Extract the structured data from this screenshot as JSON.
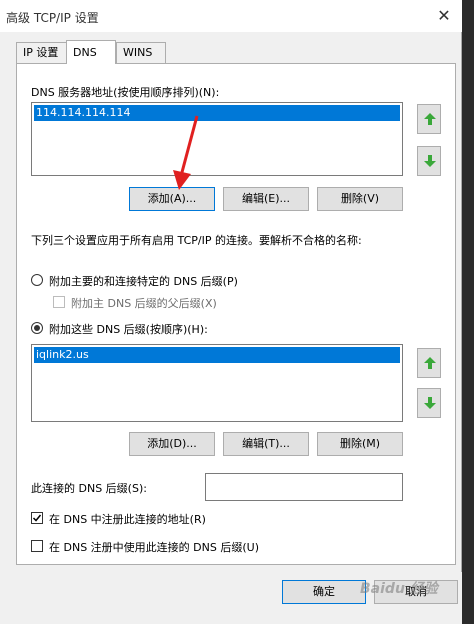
{
  "window": {
    "title": "高级 TCP/IP 设置",
    "close_glyph": "✕"
  },
  "tabs": [
    {
      "label": "IP 设置",
      "active": false
    },
    {
      "label": "DNS",
      "active": true
    },
    {
      "label": "WINS",
      "active": false
    }
  ],
  "dns_servers": {
    "label": "DNS 服务器地址(按使用顺序排列)(N):",
    "items": [
      "114.114.114.114"
    ],
    "add_label": "添加(A)...",
    "edit_label": "编辑(E)...",
    "remove_label": "删除(V)"
  },
  "description": "下列三个设置应用于所有启用 TCP/IP 的连接。要解析不合格的名称:",
  "options": {
    "primary_suffix_label": "附加主要的和连接特定的 DNS 后缀(P)",
    "parent_suffix_label": "附加主 DNS 后缀的父后缀(X)",
    "these_suffixes_label": "附加这些 DNS 后缀(按顺序)(H):"
  },
  "suffix_list": {
    "items": [
      "iqlink2.us"
    ],
    "add_label": "添加(D)...",
    "edit_label": "编辑(T)...",
    "remove_label": "删除(M)"
  },
  "connection_suffix": {
    "label": "此连接的 DNS 后缀(S):",
    "value": ""
  },
  "checkboxes": {
    "register_label": "在 DNS 中注册此连接的地址(R)",
    "register_checked": true,
    "use_suffix_label": "在 DNS 注册中使用此连接的 DNS 后缀(U)",
    "use_suffix_checked": false
  },
  "footer": {
    "ok_label": "确定",
    "cancel_label": "取消"
  },
  "watermark": "Baidu 经验",
  "colors": {
    "selection": "#0078d7",
    "arrow_green": "#3aa83a",
    "annotation_red": "#e02020"
  }
}
